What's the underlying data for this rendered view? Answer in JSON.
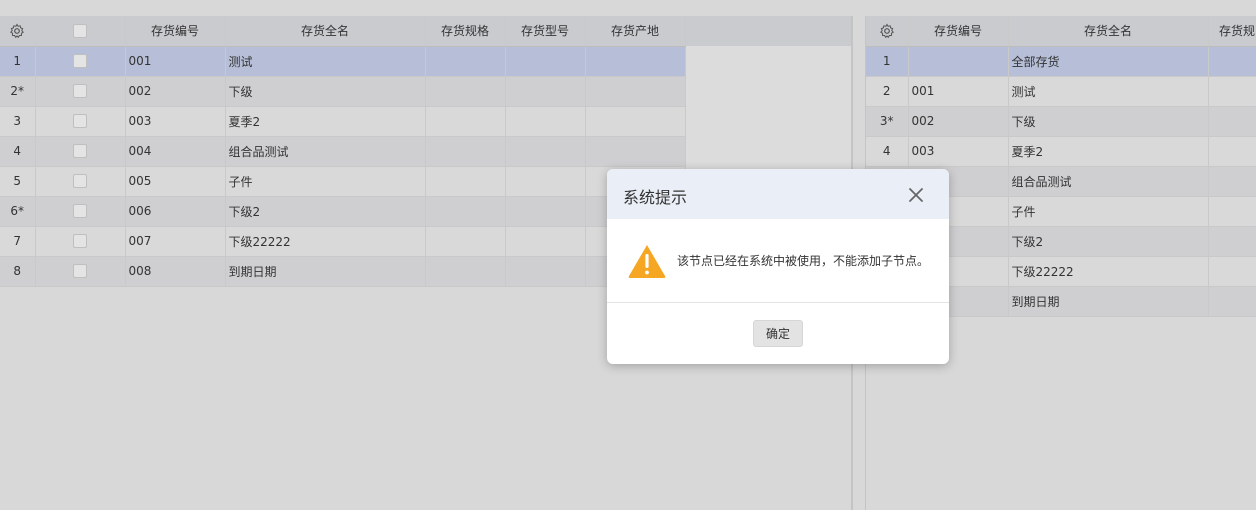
{
  "left_grid": {
    "columns": [
      "存货编号",
      "存货全名",
      "存货规格",
      "存货型号",
      "存货产地"
    ],
    "rows": [
      {
        "idx": "1",
        "code": "001",
        "name": "测试"
      },
      {
        "idx": "2*",
        "code": "002",
        "name": "下级"
      },
      {
        "idx": "3",
        "code": "003",
        "name": "夏季2"
      },
      {
        "idx": "4",
        "code": "004",
        "name": "组合品测试"
      },
      {
        "idx": "5",
        "code": "005",
        "name": "子件"
      },
      {
        "idx": "6*",
        "code": "006",
        "name": "下级2"
      },
      {
        "idx": "7",
        "code": "007",
        "name": "下级22222"
      },
      {
        "idx": "8",
        "code": "008",
        "name": "到期日期"
      }
    ]
  },
  "right_grid": {
    "columns": [
      "存货编号",
      "存货全名",
      "存货规"
    ],
    "rows": [
      {
        "idx": "1",
        "code": "",
        "name": "全部存货"
      },
      {
        "idx": "2",
        "code": "001",
        "name": "测试"
      },
      {
        "idx": "3*",
        "code": "002",
        "name": "下级"
      },
      {
        "idx": "4",
        "code": "003",
        "name": "夏季2"
      },
      {
        "idx": "",
        "code": "",
        "name": "组合品测试"
      },
      {
        "idx": "",
        "code": "",
        "name": "子件"
      },
      {
        "idx": "",
        "code": "",
        "name": "下级2"
      },
      {
        "idx": "",
        "code": "",
        "name": "下级22222"
      },
      {
        "idx": "",
        "code": "",
        "name": "到期日期"
      }
    ]
  },
  "dialog": {
    "title": "系统提示",
    "message": "该节点已经在系统中被使用，不能添加子节点。",
    "ok_label": "确定",
    "icon": "warning-icon",
    "warning_color": "#f5a623"
  },
  "colors": {
    "selected_row": "#b7bfd8",
    "header_bg": "#c9cbcf",
    "dialog_header_bg": "#eaeef6"
  }
}
